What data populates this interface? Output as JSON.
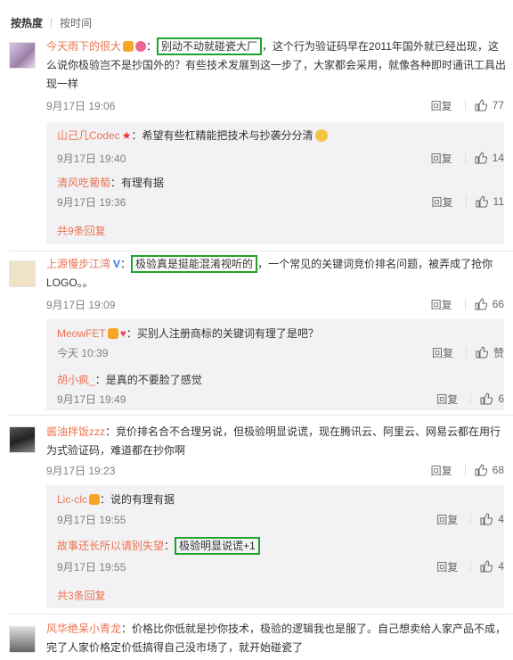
{
  "sort": {
    "hot": "按热度",
    "time": "按时间"
  },
  "comments": [
    {
      "user": "今天雨下的很大",
      "highlight": "别动不动就碰瓷大厂",
      "text_rest": "，这个行为验证码早在2011年国外就已经出现，这么说你极验岂不是抄国外的？有些技术发展到这一步了，大家都会采用，就像各种即时通讯工具出现一样",
      "time": "9月17日 19:06",
      "reply": "回复",
      "likes": "77",
      "replies": [
        {
          "user": "山己几Codec",
          "text": "：希望有些杠精能把技术与抄袭分分清",
          "time": "9月17日 19:40",
          "reply": "回复",
          "likes": "14"
        },
        {
          "user": "清风吃葡萄",
          "text": "：有理有据",
          "time": "9月17日 19:36",
          "reply": "回复",
          "likes": "11"
        }
      ],
      "more": "共9条回复"
    },
    {
      "user": "上源慢步江湾",
      "highlight": "极验真是挺能混淆视听的",
      "text_rest": "，一个常见的关键词竞价排名问题，被弄成了抢你LOGO。。",
      "time": "9月17日 19:09",
      "reply": "回复",
      "likes": "66",
      "replies": [
        {
          "user": "MeowFET",
          "text": "：买别人注册商标的关键词有理了是吧？",
          "time": "今天 10:39",
          "reply": "回复",
          "likes": "赞"
        },
        {
          "user": "胡小疯_",
          "text": "：是真的不要脸了感觉",
          "time": "9月17日 19:49",
          "reply": "回复",
          "likes": "6"
        }
      ]
    },
    {
      "user": "酱油拌饭zzz",
      "text_rest": "：竞价排名合不合理另说，但极验明显说谎，现在腾讯云、阿里云、网易云都在用行为式验证码，难道都在抄你啊",
      "time": "9月17日 19:23",
      "reply": "回复",
      "likes": "68",
      "replies": [
        {
          "user": "Lic-clc",
          "text": "：说的有理有据",
          "time": "9月17日 19:55",
          "reply": "回复",
          "likes": "4"
        },
        {
          "user": "故事还长所以请别失望",
          "highlight": "极验明显说谎+1",
          "text": "",
          "time": "9月17日 19:55",
          "reply": "回复",
          "likes": "4"
        }
      ],
      "more": "共3条回复"
    },
    {
      "user": "风华绝呆小青龙",
      "text_rest": "：价格比你低就是抄你技术，极验的逻辑我也是服了。自己想卖给人家产品不成，完了人家价格定价低搞得自己没市场了，就开始碰瓷了"
    }
  ],
  "colors": {
    "username": "#eb7350",
    "highlight_border": "#1da32a",
    "reply_bg": "#f2f2f5"
  },
  "icons": {
    "like": "thumb-up-icon",
    "verified": "blue-v-icon",
    "flame": "red-star-icon"
  },
  "badges": {
    "verified_v": "V"
  }
}
